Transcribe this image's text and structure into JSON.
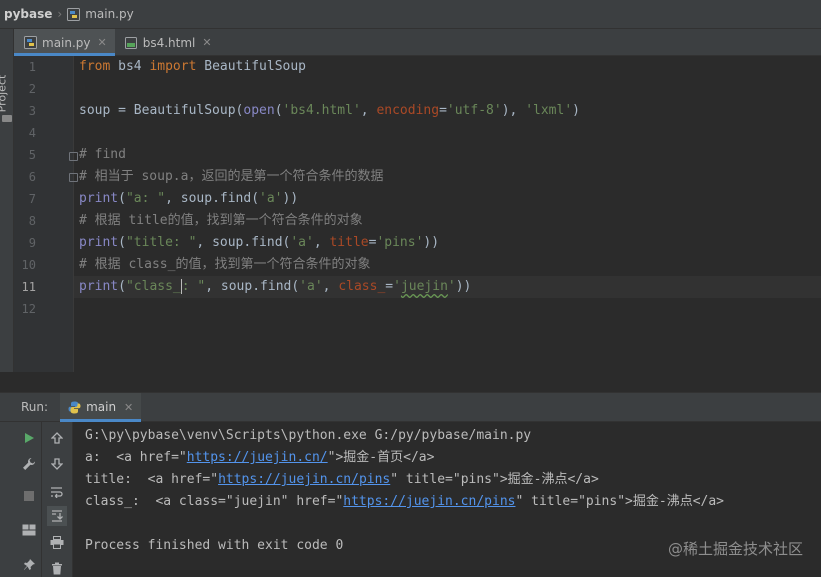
{
  "breadcrumb": {
    "project": "pybase",
    "file": "main.py"
  },
  "sidebar": {
    "project_label": "Project"
  },
  "tabs": [
    {
      "label": "main.py",
      "active": true,
      "icon": "python-file-icon"
    },
    {
      "label": "bs4.html",
      "active": false,
      "icon": "html-file-icon"
    }
  ],
  "editor": {
    "current_line": 11,
    "lines": [
      {
        "n": "1"
      },
      {
        "n": "2"
      },
      {
        "n": "3"
      },
      {
        "n": "4"
      },
      {
        "n": "5"
      },
      {
        "n": "6"
      },
      {
        "n": "7"
      },
      {
        "n": "8"
      },
      {
        "n": "9"
      },
      {
        "n": "10"
      },
      {
        "n": "11"
      },
      {
        "n": "12"
      }
    ],
    "code": {
      "l1_from": "from",
      "l1_mod": " bs4 ",
      "l1_import": "import",
      "l1_name": " BeautifulSoup",
      "l3_a": "soup = BeautifulSoup(",
      "l3_open": "open",
      "l3_b": "(",
      "l3_s1": "'bs4.html'",
      "l3_c": ", ",
      "l3_p": "encoding",
      "l3_d": "=",
      "l3_s2": "'utf-8'",
      "l3_e": "), ",
      "l3_s3": "'lxml'",
      "l3_f": ")",
      "l5": "# find",
      "l6": "# 相当于 soup.a，返回的是第一个符合条件的数据",
      "l7_print": "print",
      "l7_a": "(",
      "l7_s1": "\"a: \"",
      "l7_b": ", soup.find(",
      "l7_s2": "'a'",
      "l7_c": "))",
      "l8": "# 根据 title的值，找到第一个符合条件的对象",
      "l9_print": "print",
      "l9_a": "(",
      "l9_s1": "\"title: \"",
      "l9_b": ", soup.find(",
      "l9_s2": "'a'",
      "l9_c": ", ",
      "l9_p": "title",
      "l9_d": "=",
      "l9_s3": "'pins'",
      "l9_e": "))",
      "l10": "# 根据 class_的值，找到第一个符合条件的对象",
      "l11_print": "print",
      "l11_a": "(",
      "l11_s1a": "\"class_",
      "l11_s1b": ": \"",
      "l11_b": ", soup.find(",
      "l11_s2": "'a'",
      "l11_c": ", ",
      "l11_p": "class_",
      "l11_d": "=",
      "l11_s3q1": "'",
      "l11_s3w": "juejin",
      "l11_s3q2": "'",
      "l11_e": "))"
    }
  },
  "run": {
    "label": "Run:",
    "tab": "main",
    "console": {
      "cmd": "G:\\py\\pybase\\venv\\Scripts\\python.exe G:/py/pybase/main.py",
      "o1_pre": "a:  <a href=\"",
      "o1_link": "https://juejin.cn/",
      "o1_post": "\">掘金-首页</a>",
      "o2_pre": "title:  <a href=\"",
      "o2_link": "https://juejin.cn/pins",
      "o2_post": "\" title=\"pins\">掘金-沸点</a>",
      "o3_pre": "class_:  <a class=\"juejin\" href=\"",
      "o3_link": "https://juejin.cn/pins",
      "o3_post": "\" title=\"pins\">掘金-沸点</a>",
      "finish": "Process finished with exit code 0"
    }
  },
  "watermark": "@稀土掘金技术社区",
  "colors": {
    "keyword": "#cc7832",
    "string": "#6a8759",
    "comment": "#808080",
    "param": "#aa4926",
    "builtin": "#8888c6",
    "link": "#5394ec",
    "accent": "#4a88c7"
  }
}
